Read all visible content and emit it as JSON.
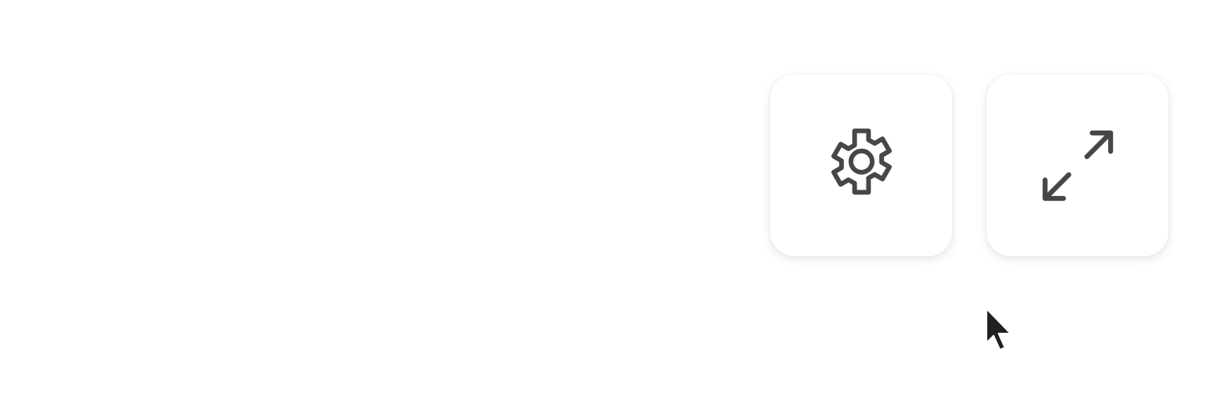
{
  "toolbar": {
    "buttons": [
      {
        "name": "settings-button",
        "icon": "gear-icon"
      },
      {
        "name": "expand-button",
        "icon": "expand-arrows-icon"
      }
    ]
  },
  "colors": {
    "background": "#ffffff",
    "button_background": "#ffffff",
    "icon": "#474747",
    "cursor": "#231f20"
  },
  "cursor": {
    "icon": "mouse-pointer-icon"
  }
}
